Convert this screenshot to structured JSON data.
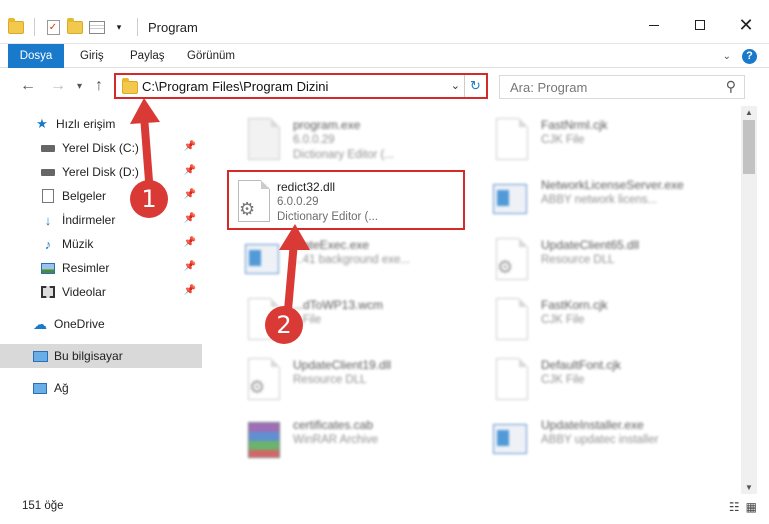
{
  "window": {
    "title": "Program"
  },
  "ribbon": {
    "tabs": [
      "Dosya",
      "Giriş",
      "Paylaş",
      "Görünüm"
    ],
    "help": "?"
  },
  "address": {
    "path": "C:\\Program Files\\Program Dizini",
    "search_placeholder": "Ara: Program"
  },
  "sidebar": {
    "items": [
      {
        "label": "Hızlı erişim",
        "icon": "star-icon"
      },
      {
        "label": "Yerel Disk (C:)",
        "icon": "drive-icon"
      },
      {
        "label": "Yerel Disk (D:)",
        "icon": "drive-icon"
      },
      {
        "label": "Belgeler",
        "icon": "documents-icon"
      },
      {
        "label": "İndirmeler",
        "icon": "download-icon"
      },
      {
        "label": "Müzik",
        "icon": "music-icon"
      },
      {
        "label": "Resimler",
        "icon": "pictures-icon"
      },
      {
        "label": "Videolar",
        "icon": "videos-icon"
      },
      {
        "label": "OneDrive",
        "icon": "cloud-icon"
      },
      {
        "label": "Bu bilgisayar",
        "icon": "computer-icon"
      },
      {
        "label": "Ağ",
        "icon": "network-icon"
      }
    ]
  },
  "files": [
    {
      "name": "program.exe",
      "line2": "6.0.0.29",
      "line3": "Dictionary Editor (...",
      "icon": "exe-icon"
    },
    {
      "name": "FastNrml.cjk",
      "line2": "CJK File",
      "line3": "",
      "icon": "doc-icon"
    },
    {
      "name": "redict32.dll",
      "line2": "6.0.0.29",
      "line3": "Dictionary Editor (...",
      "icon": "dll-gear-icon"
    },
    {
      "name": "NetworkLicenseServer.exe",
      "line2": "ABBY network licens...",
      "line3": "",
      "icon": "app-window-icon"
    },
    {
      "name": "...ateExec.exe",
      "line2": "...41 background exe...",
      "line3": "",
      "icon": "app-window-icon"
    },
    {
      "name": "UpdateClient65.dll",
      "line2": "Resource DLL",
      "line3": "",
      "icon": "dll-gear-icon"
    },
    {
      "name": "...dToWP13.wcm",
      "line2": "...File",
      "line3": "",
      "icon": "doc-icon"
    },
    {
      "name": "FastKorn.cjk",
      "line2": "CJK File",
      "line3": "",
      "icon": "doc-icon"
    },
    {
      "name": "UpdateClient19.dll",
      "line2": "Resource DLL",
      "line3": "",
      "icon": "dll-gear-icon"
    },
    {
      "name": "DefaultFont.cjk",
      "line2": "CJK File",
      "line3": "",
      "icon": "doc-icon"
    },
    {
      "name": "certificates.cab",
      "line2": "WinRAR Archive",
      "line3": "",
      "icon": "archive-icon"
    },
    {
      "name": "UpdateInstaller.exe",
      "line2": "ABBY updatec installer",
      "line3": "",
      "icon": "app-window-icon"
    }
  ],
  "status": {
    "count": "151 öğe"
  },
  "annotations": {
    "badge1": "1",
    "badge2": "2",
    "color": "#d93a36"
  }
}
